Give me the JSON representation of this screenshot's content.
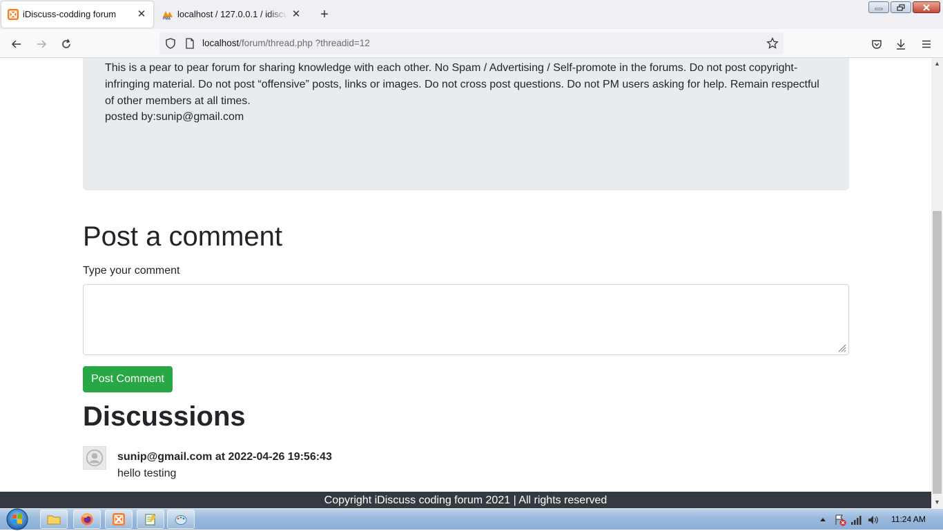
{
  "browser": {
    "tabs": [
      {
        "title": "iDiscuss-codding forum",
        "active": true,
        "favicon": "xampp-icon"
      },
      {
        "title": "localhost / 127.0.0.1 / idiscuss / ",
        "active": false,
        "favicon": "phpmyadmin-icon"
      }
    ],
    "url_host": "localhost",
    "url_path": "/forum/thread.php ?threadid=12"
  },
  "thread": {
    "description": "This is a pear to pear forum for sharing knowledge with each other. No Spam / Advertising / Self-promote in the forums. Do not post copyright-infringing material. Do not post “offensive” posts, links or images. Do not cross post questions. Do not PM users asking for help. Remain respectful of other members at all times.",
    "posted_by": "posted by:sunip@gmail.com"
  },
  "comment_form": {
    "heading": "Post a comment",
    "label": "Type your comment",
    "value": "",
    "button": "Post Comment",
    "button_color": "#28a745"
  },
  "discussions": {
    "heading": "Discussions",
    "comments": [
      {
        "meta": "sunip@gmail.com at 2022-04-26 19:56:43",
        "text": "hello testing"
      }
    ]
  },
  "footer": {
    "text": "Copyright iDiscuss coding forum 2021 | All rights reserved",
    "bg": "#343a40"
  },
  "taskbar": {
    "apps": [
      "explorer-icon",
      "firefox-icon",
      "xampp-icon",
      "notepad-icon",
      "paint-icon"
    ],
    "clock": "11:24 AM"
  }
}
